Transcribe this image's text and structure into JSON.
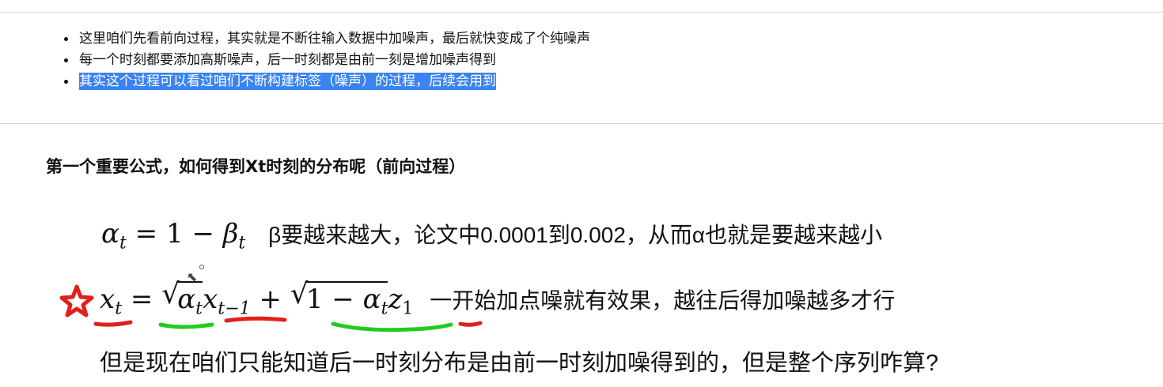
{
  "bullets": [
    {
      "text": "这里咱们先看前向过程，其实就是不断往输入数据中加噪声，最后就快变成了个纯噪声",
      "selected": false
    },
    {
      "text": "每一个时刻都要添加高斯噪声，后一时刻都是由前一刻是增加噪声得到",
      "selected": false
    },
    {
      "text": "其实这个过程可以看过咱们不断构建标签（噪声）的过程，后续会用到",
      "selected": true
    }
  ],
  "section_title": "第一个重要公式，如何得到Xt时刻的分布呢（前向过程）",
  "formula1": {
    "note": "β要越来越大，论文中0.0001到0.002，从而α也就是要越来越小"
  },
  "formula2": {
    "note": "一开始加点噪就有效果，越往后得加噪越多才行"
  },
  "line3_text": "但是现在咱们只能知道后一时刻分布是由前一时刻加噪得到的，但是整个序列咋算?",
  "colors": {
    "selection": "#3b83f0",
    "red_annotation": "#e0201b",
    "green_annotation": "#22cc22",
    "star": "#e0201b"
  },
  "icons": {
    "star": "star-icon",
    "cursor": "mouse-cursor-icon"
  }
}
